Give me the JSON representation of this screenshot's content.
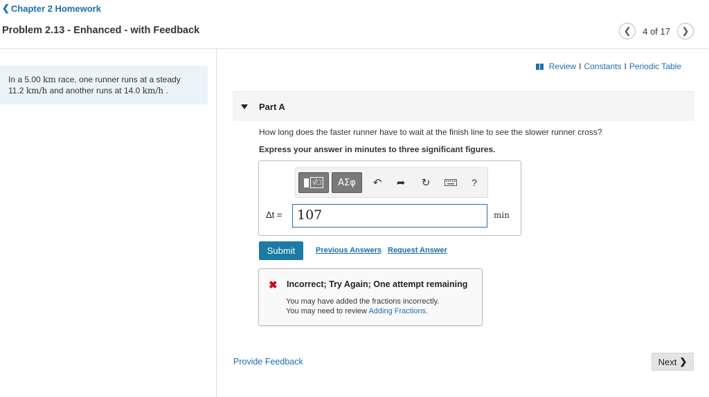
{
  "header": {
    "breadcrumb_label": "Chapter 2 Homework",
    "problem_title": "Problem 2.13 - Enhanced - with Feedback",
    "pager_text": "4 of 17"
  },
  "problem": {
    "text_1": "In a 5.00 ",
    "unit_km": "km",
    "text_2": " race, one runner runs at a steady",
    "speed_1": "11.2 ",
    "unit_kmh_1": "km/h",
    "text_3": " and another runs at 14.0 ",
    "unit_kmh_2": "km/h",
    "text_4": " ."
  },
  "resources": {
    "review": "Review",
    "constants": "Constants",
    "periodic_table": "Periodic Table",
    "separator": "I"
  },
  "part": {
    "label": "Part A",
    "question": "How long does the faster runner have to wait at the finish line to see the slower runner cross?",
    "instruction": "Express your answer in minutes to three significant figures."
  },
  "toolbar": {
    "greek_label": "ΑΣφ",
    "help_label": "?"
  },
  "answer": {
    "variable_label": "Δt =",
    "value": "107",
    "unit": "min"
  },
  "actions": {
    "submit_label": "Submit",
    "previous_answers_label": "Previous Answers",
    "request_answer_label": "Request Answer"
  },
  "feedback": {
    "title": "Incorrect; Try Again; One attempt remaining",
    "line_1": "You may have added the fractions incorrectly.",
    "line_2_prefix": "You may need to review ",
    "line_2_link": "Adding Fractions",
    "line_2_suffix": "."
  },
  "footer": {
    "provide_feedback_label": "Provide Feedback",
    "next_label": "Next"
  },
  "colors": {
    "accent": "#1a6fb0",
    "submit": "#1b7aa6",
    "error": "#d0021b",
    "problem_bg": "#e8f4f6"
  }
}
